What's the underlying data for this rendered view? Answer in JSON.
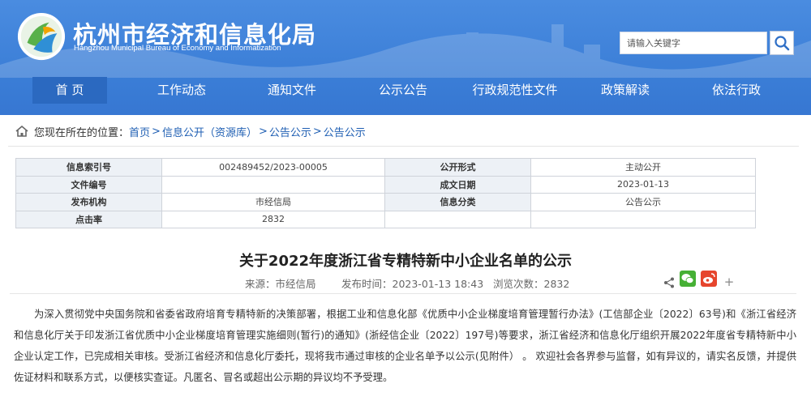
{
  "header": {
    "title": "杭州市经济和信息化局",
    "subtitle": "Hangzhou Municipal Bureau of Economy and Informatization",
    "search_placeholder": "请输入关键字",
    "colors": {
      "primary": "#3c7fd8",
      "nav_active": "#2b69c0",
      "link": "#1f5fb3"
    }
  },
  "nav": {
    "items": [
      {
        "label": "首 页",
        "active": true
      },
      {
        "label": "工作动态"
      },
      {
        "label": "通知文件"
      },
      {
        "label": "公示公告"
      },
      {
        "label": "行政规范性文件"
      },
      {
        "label": "政策解读"
      },
      {
        "label": "依法行政"
      }
    ]
  },
  "breadcrumb": {
    "prefix": "您现在所在的位置：",
    "items": [
      "首页",
      "信息公开（资源库）",
      "公告公示",
      "公告公示"
    ],
    "separator": ">"
  },
  "info_table": {
    "rows": [
      {
        "k1": "信息索引号",
        "v1": "002489452/2023-00005",
        "k2": "公开形式",
        "v2": "主动公开"
      },
      {
        "k1": "文件编号",
        "v1": "",
        "k2": "成文日期",
        "v2": "2023-01-13"
      },
      {
        "k1": "发布机构",
        "v1": "市经信局",
        "k2": "信息分类",
        "v2": "公告公示"
      },
      {
        "k1": "点击率",
        "v1": "2832",
        "k2": "",
        "v2": ""
      }
    ]
  },
  "article": {
    "title": "关于2022年度浙江省专精特新中小企业名单的公示",
    "source_label": "来源：市经信局",
    "date_label": "发布时间：2023-01-13 18:43",
    "views_label": "浏览次数：2832",
    "share_plus": "+",
    "body": "为深入贯彻党中央国务院和省委省政府培育专精特新的决策部署，根据工业和信息化部《优质中小企业梯度培育管理暂行办法》(工信部企业〔2022〕63号)和《浙江省经济和信息化厅关于印发浙江省优质中小企业梯度培育管理实施细则(暂行)的通知》(浙经信企业〔2022〕197号)等要求，浙江省经济和信息化厅组织开展2022年度省专精特新中小企业认定工作，已完成相关审核。受浙江省经济和信息化厅委托，现将我市通过审核的企业名单予以公示(见附件） 。   欢迎社会各界参与监督，如有异议的，请实名反馈，并提供佐证材料和联系方式，以便核实查证。凡匿名、冒名或超出公示期的异议均不予受理。"
  },
  "icons": [
    "logo-emblem",
    "search-icon",
    "home-icon",
    "share-icon",
    "wechat-icon",
    "weibo-icon"
  ]
}
